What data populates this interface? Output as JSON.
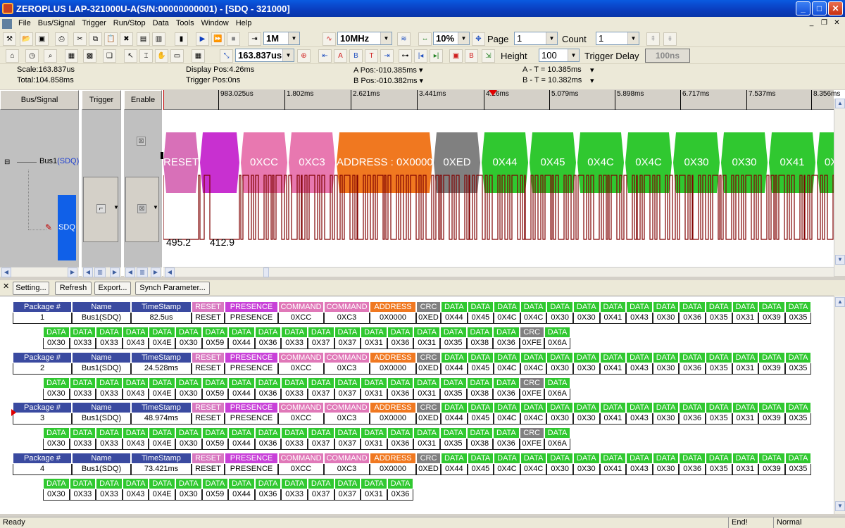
{
  "window": {
    "title": "ZEROPLUS LAP-321000U-A(S/N:00000000001) - [SDQ - 321000]"
  },
  "menu": [
    "File",
    "Bus/Signal",
    "Trigger",
    "Run/Stop",
    "Data",
    "Tools",
    "Window",
    "Help"
  ],
  "toolbar": {
    "memory": "1M",
    "frequency": "10MHz",
    "trigger_percent": "10%",
    "page_label": "Page",
    "page_value": "1",
    "count_label": "Count",
    "count_value": "1",
    "scale_value": "163.837us",
    "height_label": "Height",
    "height_value": "100",
    "trigger_delay_label": "Trigger Delay",
    "trigger_delay_value": "100ns"
  },
  "info": {
    "scale": "Scale:163.837us",
    "total": "Total:104.858ms",
    "display_pos": "Display Pos:4.26ms",
    "trigger_pos": "Trigger Pos:0ns",
    "a_pos": "A Pos:-010.385ms",
    "b_pos": "B Pos:-010.382ms",
    "a_t": "A - T = 10.385ms",
    "b_t": "B - T = 10.382ms"
  },
  "columns": {
    "bus_signal": "Bus/Signal",
    "trigger": "Trigger",
    "enable": "Enable"
  },
  "bus": {
    "name": "Bus1",
    "protocol": "(SDQ)",
    "signal": "SDQ"
  },
  "ruler": [
    "983.025us",
    "1.802ms",
    "2.621ms",
    "3.441ms",
    "4.26ms",
    "5.079ms",
    "5.898ms",
    "6.717ms",
    "7.537ms",
    "8.356ms"
  ],
  "segments": [
    {
      "label": "RESET",
      "color": "#d870b8"
    },
    {
      "label": "",
      "color": "#c830d0"
    },
    {
      "label": "0XCC",
      "color": "#e878b0"
    },
    {
      "label": "0XC3",
      "color": "#e878b0"
    },
    {
      "label": "ADDRESS : 0X0000",
      "color": "#f07820"
    },
    {
      "label": "0XED",
      "color": "#808080"
    },
    {
      "label": "0X44",
      "color": "#30c830"
    },
    {
      "label": "0X45",
      "color": "#30c830"
    },
    {
      "label": "0X4C",
      "color": "#30c830"
    },
    {
      "label": "0X4C",
      "color": "#30c830"
    },
    {
      "label": "0X30",
      "color": "#30c830"
    },
    {
      "label": "0X30",
      "color": "#30c830"
    },
    {
      "label": "0X41",
      "color": "#30c830"
    },
    {
      "label": "0X",
      "color": "#30c830"
    }
  ],
  "wave_labels": [
    "495.2",
    "412.9"
  ],
  "panel_buttons": {
    "setting": "Setting...",
    "refresh": "Refresh",
    "export": "Export...",
    "synch": "Synch Parameter..."
  },
  "package_headers": {
    "package": "Package #",
    "name": "Name",
    "timestamp": "TimeStamp"
  },
  "colors": {
    "header_blue": "#3a4aa0",
    "reset": "#d878c0",
    "presence": "#c840d8",
    "command": "#e078b8",
    "address": "#f07820",
    "crc": "#808080",
    "data": "#30c830"
  },
  "packages": [
    {
      "number": "1",
      "name": "Bus1(SDQ)",
      "timestamp": "82.5us"
    },
    {
      "number": "2",
      "name": "Bus1(SDQ)",
      "timestamp": "24.528ms"
    },
    {
      "number": "3",
      "name": "Bus1(SDQ)",
      "timestamp": "48.974ms"
    },
    {
      "number": "4",
      "name": "Bus1(SDQ)",
      "timestamp": "73.421ms"
    }
  ],
  "row1_fields": [
    {
      "type": "RESET",
      "value": "RESET"
    },
    {
      "type": "PRESENCE",
      "value": "PRESENCE"
    },
    {
      "type": "COMMAND",
      "value": "0XCC"
    },
    {
      "type": "COMMAND",
      "value": "0XC3"
    },
    {
      "type": "ADDRESS",
      "value": "0X0000"
    },
    {
      "type": "CRC",
      "value": "0XED"
    },
    {
      "type": "DATA",
      "value": "0X44"
    },
    {
      "type": "DATA",
      "value": "0X45"
    },
    {
      "type": "DATA",
      "value": "0X4C"
    },
    {
      "type": "DATA",
      "value": "0X4C"
    },
    {
      "type": "DATA",
      "value": "0X30"
    },
    {
      "type": "DATA",
      "value": "0X30"
    },
    {
      "type": "DATA",
      "value": "0X41"
    },
    {
      "type": "DATA",
      "value": "0X43"
    },
    {
      "type": "DATA",
      "value": "0X30"
    },
    {
      "type": "DATA",
      "value": "0X36"
    },
    {
      "type": "DATA",
      "value": "0X35"
    },
    {
      "type": "DATA",
      "value": "0X31"
    },
    {
      "type": "DATA",
      "value": "0X39"
    },
    {
      "type": "DATA",
      "value": "0X35"
    }
  ],
  "row2_fields": [
    {
      "type": "DATA",
      "value": "0X30"
    },
    {
      "type": "DATA",
      "value": "0X33"
    },
    {
      "type": "DATA",
      "value": "0X33"
    },
    {
      "type": "DATA",
      "value": "0X43"
    },
    {
      "type": "DATA",
      "value": "0X4E"
    },
    {
      "type": "DATA",
      "value": "0X30"
    },
    {
      "type": "DATA",
      "value": "0X59"
    },
    {
      "type": "DATA",
      "value": "0X44"
    },
    {
      "type": "DATA",
      "value": "0X36"
    },
    {
      "type": "DATA",
      "value": "0X33"
    },
    {
      "type": "DATA",
      "value": "0X37"
    },
    {
      "type": "DATA",
      "value": "0X37"
    },
    {
      "type": "DATA",
      "value": "0X31"
    },
    {
      "type": "DATA",
      "value": "0X36"
    },
    {
      "type": "DATA",
      "value": "0X31"
    },
    {
      "type": "DATA",
      "value": "0X35"
    },
    {
      "type": "DATA",
      "value": "0X38"
    },
    {
      "type": "DATA",
      "value": "0X36"
    },
    {
      "type": "CRC",
      "value": "0XFE"
    },
    {
      "type": "DATA",
      "value": "0X6A"
    }
  ],
  "row2_last_fields": [
    {
      "type": "DATA",
      "value": "0X30"
    },
    {
      "type": "DATA",
      "value": "0X33"
    },
    {
      "type": "DATA",
      "value": "0X33"
    },
    {
      "type": "DATA",
      "value": "0X43"
    },
    {
      "type": "DATA",
      "value": "0X4E"
    },
    {
      "type": "DATA",
      "value": "0X30"
    },
    {
      "type": "DATA",
      "value": "0X59"
    },
    {
      "type": "DATA",
      "value": "0X44"
    },
    {
      "type": "DATA",
      "value": "0X36"
    },
    {
      "type": "DATA",
      "value": "0X33"
    },
    {
      "type": "DATA",
      "value": "0X37"
    },
    {
      "type": "DATA",
      "value": "0X37"
    },
    {
      "type": "DATA",
      "value": "0X31"
    },
    {
      "type": "DATA",
      "value": "0X36"
    }
  ],
  "status": {
    "ready": "Ready",
    "end": "End!",
    "mode": "Normal"
  }
}
